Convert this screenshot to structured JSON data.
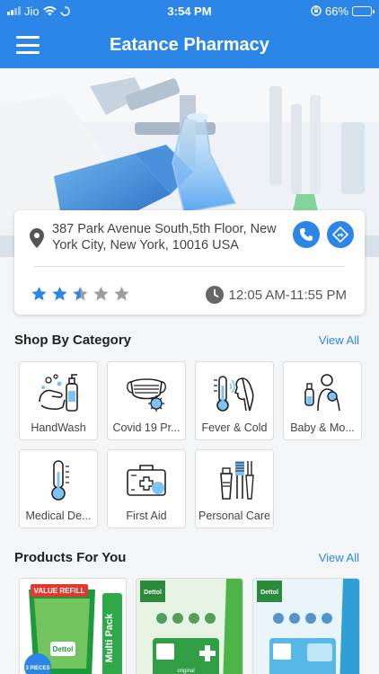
{
  "status_bar": {
    "carrier": "Jio",
    "time": "3:54 PM",
    "battery": "66%",
    "battery_level": 0.66
  },
  "app": {
    "title": "Eatance Pharmacy"
  },
  "store": {
    "address": "387 Park Avenue South,5th Floor, New York City, New York, 10016 USA",
    "rating": 2.5,
    "rating_max": 5,
    "hours": "12:05 AM-11:55 PM",
    "star_color": "#2c86e8",
    "star_empty_color": "#9e9e9e"
  },
  "categories_section": {
    "title": "Shop By Category",
    "view_all": "View All",
    "items": [
      {
        "label": "HandWash",
        "icon": "handwash-icon"
      },
      {
        "label": "Covid 19 Pr...",
        "icon": "face-mask-icon"
      },
      {
        "label": "Fever & Cold",
        "icon": "fever-icon"
      },
      {
        "label": "Baby & Mo...",
        "icon": "baby-mother-icon"
      },
      {
        "label": "Medical De...",
        "icon": "thermometer-icon"
      },
      {
        "label": "First Aid",
        "icon": "first-aid-icon"
      },
      {
        "label": "Personal Care",
        "icon": "personal-care-icon"
      }
    ]
  },
  "products_section": {
    "title": "Products For You",
    "view_all": "View All",
    "items": [
      {
        "badge": "VALUE REFILL",
        "brand": "Dettol",
        "tag": "Multi Pack",
        "count": "3 PIECES"
      },
      {
        "brand": "Dettol",
        "variant": "original"
      },
      {
        "brand": "Dettol",
        "variant": ""
      }
    ]
  },
  "colors": {
    "primary": "#2c86e8",
    "accent_green": "#3aa24a"
  }
}
